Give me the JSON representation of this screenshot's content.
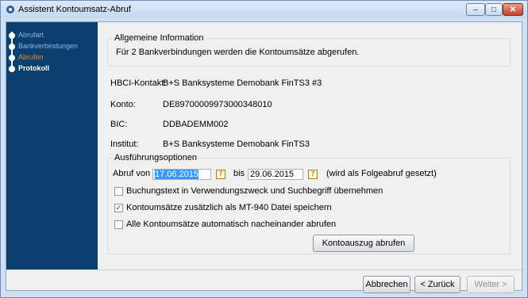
{
  "window": {
    "title": "Assistent Kontoumsatz-Abruf"
  },
  "sidebar": {
    "items": [
      {
        "label": "Abrufart",
        "state": "done"
      },
      {
        "label": "Bankverbindungen",
        "state": "done"
      },
      {
        "label": "Abrufen",
        "state": "active"
      },
      {
        "label": "Protokoll",
        "state": "current"
      }
    ]
  },
  "info": {
    "legend": "Allgemeine Information",
    "text": "Für 2 Bankverbindungen werden die Kontoumsätze abgerufen."
  },
  "details": {
    "hbci_label": "HBCI-Kontakt:",
    "hbci_value": "B+S Banksysteme Demobank FinTS3 #3",
    "konto_label": "Konto:",
    "konto_value": "DE89700009973000348010",
    "bic_label": "BIC:",
    "bic_value": "DDBADEMM002",
    "institut_label": "Institut:",
    "institut_value": "B+S Banksysteme Demobank FinTS3"
  },
  "options": {
    "legend": "Ausführungsoptionen",
    "abruf_label": "Abruf von",
    "date_from": "17.06.2015",
    "bis_label": "bis",
    "date_to": "29.06.2015",
    "note": "(wird als Folgeabruf gesetzt)",
    "checkbox1": "Buchungstext in Verwendungszweck und Suchbegriff übernehmen",
    "checkbox1_checked": false,
    "checkbox2": "Kontoumsätze zusätzlich als MT-940 Datei speichern",
    "checkbox2_checked": true,
    "checkbox3": "Alle Kontoumsätze automatisch nacheinander abrufen",
    "checkbox3_checked": false,
    "fetch_button": "Kontoauszug abrufen"
  },
  "footer": {
    "cancel": "Abbrechen",
    "back": "< Zurück",
    "next": "Weiter >"
  },
  "icons": {
    "title_icon": "assistant-icon",
    "calendar": "calendar-icon"
  }
}
